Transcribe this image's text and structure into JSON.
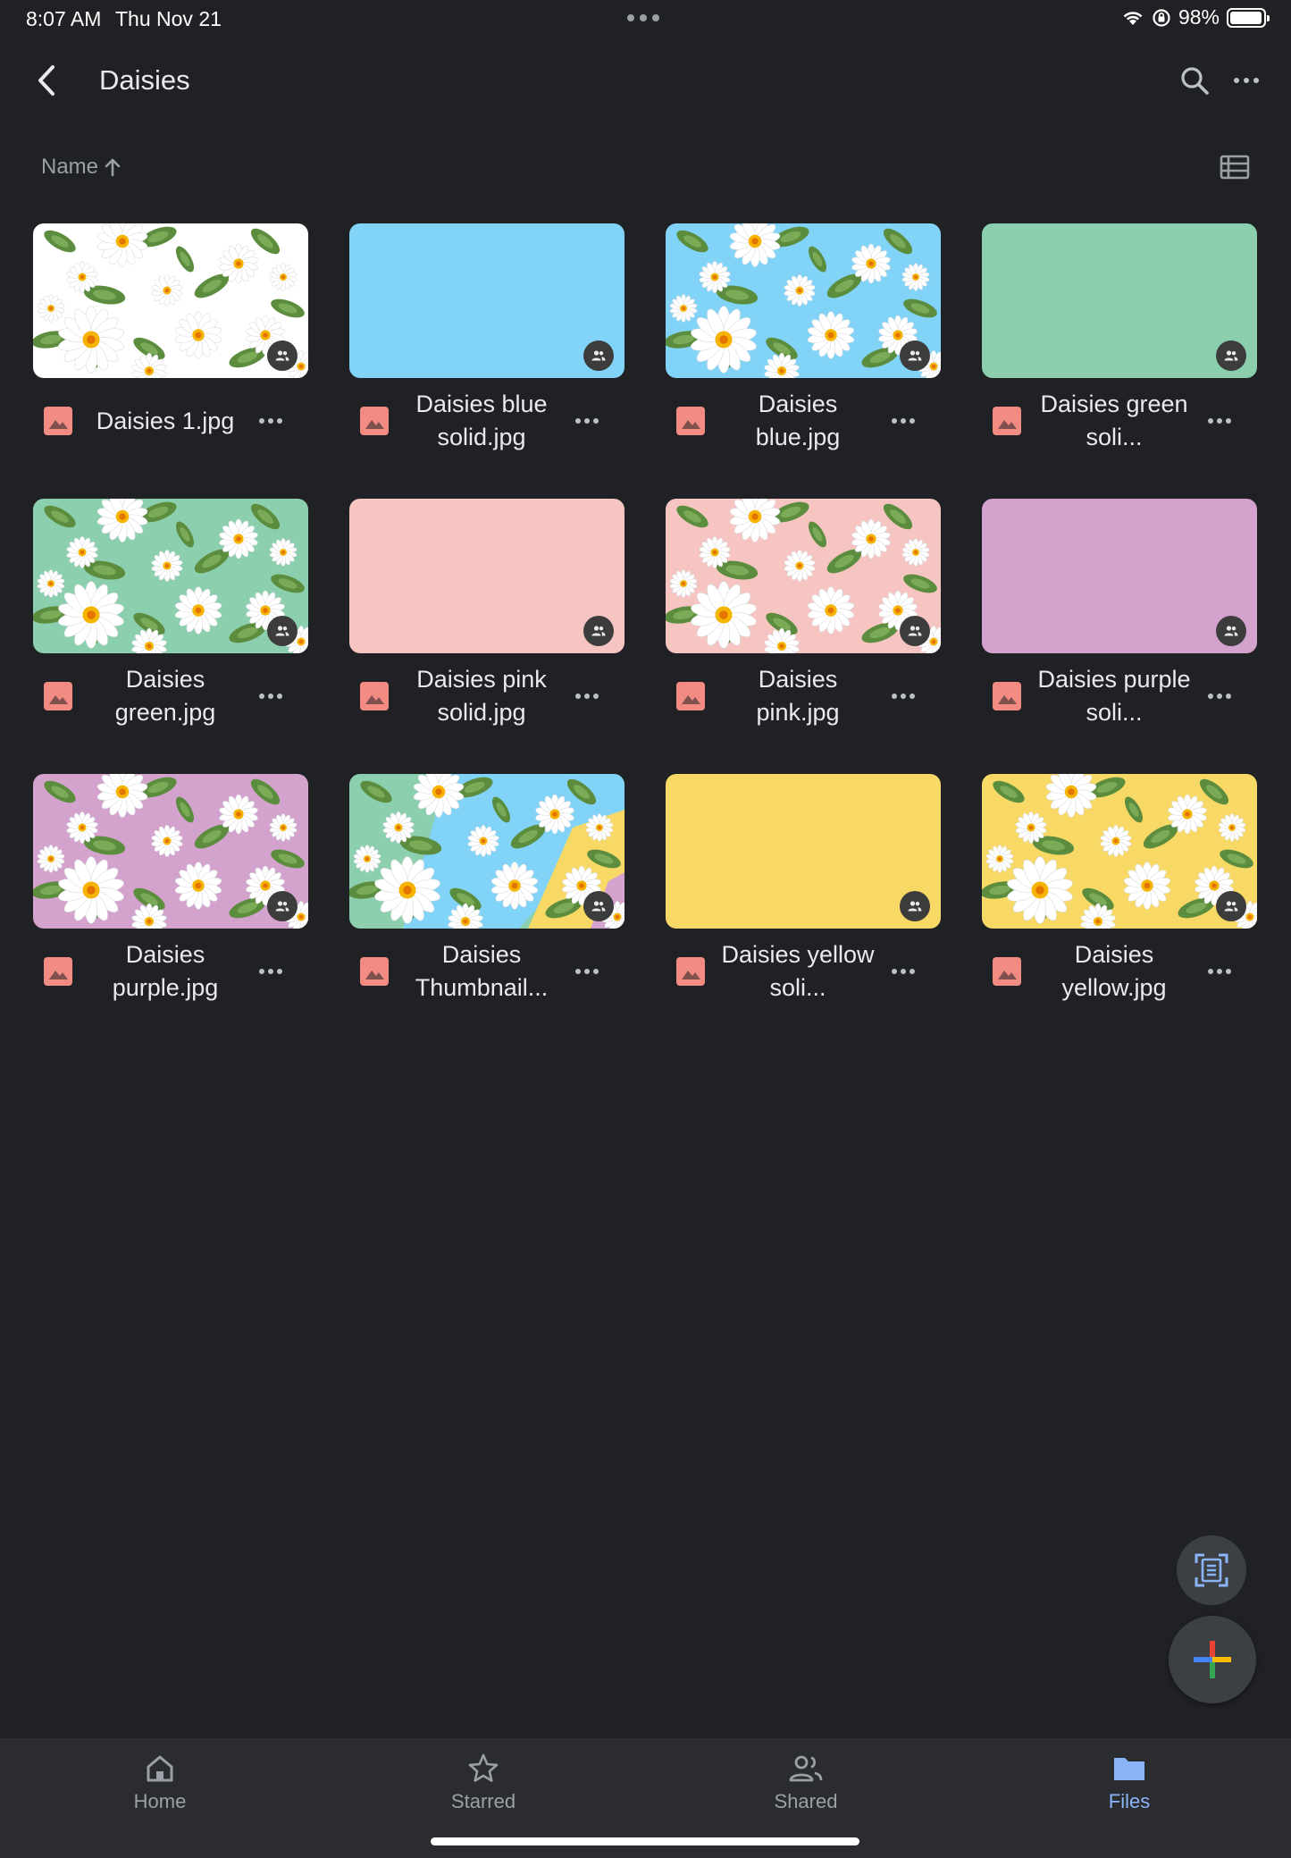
{
  "status_bar": {
    "time": "8:07 AM",
    "date": "Thu Nov 21",
    "battery_text": "98%",
    "battery_level": 0.98
  },
  "header": {
    "title": "Daisies"
  },
  "sort": {
    "label": "Name"
  },
  "files": [
    {
      "name": "Daisies 1.jpg",
      "thumb": "daisy-pattern",
      "bg": "#ffffff"
    },
    {
      "name": "Daisies blue solid.jpg",
      "thumb": "solid",
      "bg": "#81d4f7"
    },
    {
      "name": "Daisies blue.jpg",
      "thumb": "daisy-pattern",
      "bg": "#81d4f7"
    },
    {
      "name": "Daisies green soli...",
      "thumb": "solid",
      "bg": "#8ccfae"
    },
    {
      "name": "Daisies green.jpg",
      "thumb": "daisy-pattern",
      "bg": "#8ccfae"
    },
    {
      "name": "Daisies pink solid.jpg",
      "thumb": "solid",
      "bg": "#f6c5c1"
    },
    {
      "name": "Daisies pink.jpg",
      "thumb": "daisy-pattern",
      "bg": "#f6c5c1"
    },
    {
      "name": "Daisies purple soli...",
      "thumb": "solid",
      "bg": "#d3a2cd"
    },
    {
      "name": "Daisies purple.jpg",
      "thumb": "daisy-pattern",
      "bg": "#d3a2cd"
    },
    {
      "name": "Daisies Thumbnail...",
      "thumb": "daisy-multi",
      "bg": "#81d4f7"
    },
    {
      "name": "Daisies yellow soli...",
      "thumb": "solid",
      "bg": "#f9d966"
    },
    {
      "name": "Daisies yellow.jpg",
      "thumb": "daisy-pattern",
      "bg": "#f9d966"
    }
  ],
  "nav": {
    "home": "Home",
    "starred": "Starred",
    "shared": "Shared",
    "files": "Files"
  },
  "colors": {
    "background": "#202124",
    "accent": "#8ab4f8",
    "file_icon": "#f28b82"
  },
  "icons": {
    "back": "chevron-left-icon",
    "search": "search-icon",
    "more": "more-horizontal-icon",
    "sort": "arrow-up-icon",
    "view": "list-view-icon",
    "shared": "people-icon",
    "image_file": "image-file-icon",
    "scan": "document-scan-icon",
    "new": "plus-icon"
  }
}
